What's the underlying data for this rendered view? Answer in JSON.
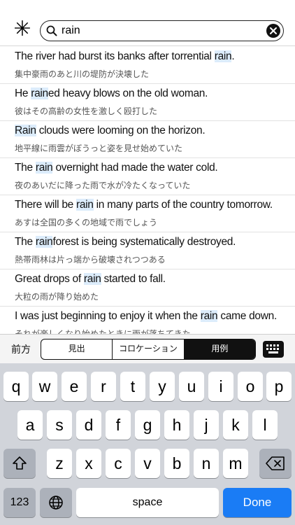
{
  "search": {
    "query": "rain",
    "star_glyph": "✳︎"
  },
  "results": [
    {
      "en_pre": "The river had burst its banks after torrential ",
      "en_hl": "rain",
      "en_post": ".",
      "ja": "集中豪雨のあと川の堤防が決壊した"
    },
    {
      "en_pre": "He ",
      "en_hl": "rain",
      "en_post": "ed heavy blows on the old woman.",
      "ja": "彼はその高齢の女性を激しく殴打した"
    },
    {
      "en_pre": "",
      "en_hl": "Rain",
      "en_post": " clouds were looming on the horizon.",
      "ja": "地平線に雨雲がぼうっと姿を見せ始めていた"
    },
    {
      "en_pre": "The ",
      "en_hl": "rain",
      "en_post": " overnight had made the water cold.",
      "ja": "夜のあいだに降った雨で水が冷たくなっていた"
    },
    {
      "en_pre": "There will be ",
      "en_hl": "rain",
      "en_post": " in many parts of the country tomorrow.",
      "ja": "あすは全国の多くの地域で雨でしょう"
    },
    {
      "en_pre": "The ",
      "en_hl": "rain",
      "en_post": "forest is being systematically destroyed.",
      "ja": "熱帯雨林は片っ端から破壊されつつある"
    },
    {
      "en_pre": "Great drops of ",
      "en_hl": "rain",
      "en_post": " started to fall.",
      "ja": "大粒の雨が降り始めた"
    },
    {
      "en_pre": "I was just beginning to enjoy it when the ",
      "en_hl": "rain",
      "en_post": " came down.",
      "ja": "それが楽しくなり始めたときに雨が落ちてきた"
    }
  ],
  "toolbar": {
    "label": "前方",
    "segments": [
      "見出",
      "コロケーション",
      "用例"
    ],
    "active_segment": "用例"
  },
  "keyboard": {
    "row1": [
      "q",
      "w",
      "e",
      "r",
      "t",
      "y",
      "u",
      "i",
      "o",
      "p"
    ],
    "row2": [
      "a",
      "s",
      "d",
      "f",
      "g",
      "h",
      "j",
      "k",
      "l"
    ],
    "row3": [
      "z",
      "x",
      "c",
      "v",
      "b",
      "n",
      "m"
    ],
    "numbers_label": "123",
    "space_label": "space",
    "done_label": "Done"
  },
  "colors": {
    "highlight": "#dcecfb",
    "done_key": "#1a7cf5",
    "keyboard_bg": "#d1d4da"
  }
}
